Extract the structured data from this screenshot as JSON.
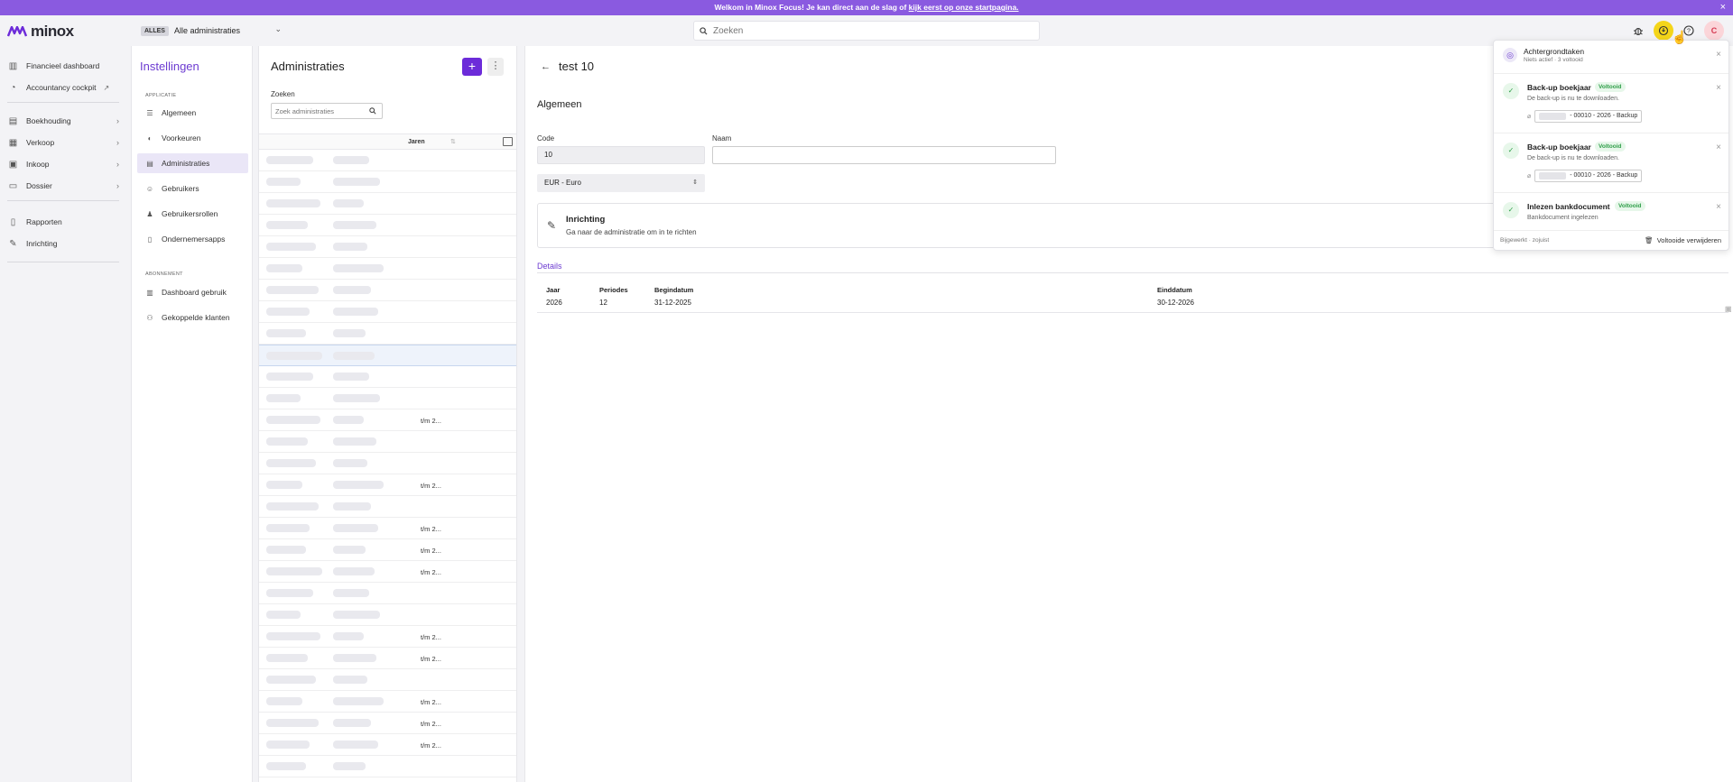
{
  "banner": {
    "text": "Welkom in Minox Focus! Je kan direct aan de slag of ",
    "link": "kijk eerst op onze startpagina.",
    "close": "×"
  },
  "app": {
    "logo_text": "minox"
  },
  "admin_selector": {
    "badge": "ALLES",
    "label": "Alle administraties"
  },
  "search": {
    "placeholder": "Zoeken"
  },
  "user": {
    "initial": "C"
  },
  "nav": [
    {
      "label": "Financieel dashboard",
      "icon": "chart-icon"
    },
    {
      "label": "Accountancy cockpit",
      "icon": "gauge-icon"
    },
    {
      "label": "Boekhouding",
      "icon": "book-icon"
    },
    {
      "label": "Verkoop",
      "icon": "cash-register-icon"
    },
    {
      "label": "Inkoop",
      "icon": "cart-icon"
    },
    {
      "label": "Dossier",
      "icon": "folder-icon"
    },
    {
      "label": "Rapporten",
      "icon": "report-icon"
    },
    {
      "label": "Inrichting",
      "icon": "wrench-icon"
    }
  ],
  "settings": {
    "title": "Instellingen",
    "section_app": "APPLICATIE",
    "section_sub": "ABONNEMENT",
    "items": [
      {
        "label": "Algemeen"
      },
      {
        "label": "Voorkeuren"
      },
      {
        "label": "Administraties"
      },
      {
        "label": "Gebruikers"
      },
      {
        "label": "Gebruikersrollen"
      },
      {
        "label": "Ondernemersapps"
      },
      {
        "label": "Dashboard gebruik"
      },
      {
        "label": "Gekoppelde klanten"
      }
    ]
  },
  "admin_list": {
    "title": "Administraties",
    "search_label": "Zoeken",
    "search_placeholder": "Zoek administraties",
    "column": "Jaren",
    "add": "+",
    "more": "⋮",
    "periods": [
      "",
      "",
      "",
      "",
      "",
      "",
      "",
      "",
      "",
      "",
      "",
      "",
      "t/m 2...",
      "",
      "",
      "t/m 2...",
      "",
      "t/m 2...",
      "t/m 2...",
      "t/m 2...",
      "",
      "",
      "t/m 2...",
      "t/m 2...",
      "",
      "t/m 2...",
      "t/m 2...",
      "t/m 2...",
      "",
      ""
    ]
  },
  "detail": {
    "title": "test 10",
    "section": "Algemeen",
    "code_label": "Code",
    "code_value": "10",
    "name_label": "Naam",
    "currency": "EUR - Euro",
    "inrichting_title": "Inrichting",
    "inrichting_sub": "Ga naar de administratie om in te richten",
    "details_tab": "Details",
    "table": {
      "headers": [
        "Jaar",
        "Periodes",
        "Begindatum",
        "Einddatum"
      ],
      "row": [
        "2026",
        "12",
        "31-12-2025",
        "30-12-2026"
      ]
    }
  },
  "tasks_panel": {
    "title": "Achtergrondtaken",
    "subtitle": "Niets actief · 3 voltooid",
    "tasks": [
      {
        "title": "Back-up boekjaar",
        "status": "Voltooid",
        "subtitle": "De back-up is nu te downloaden.",
        "file": "- 00010 - 2026 - Backup"
      },
      {
        "title": "Back-up boekjaar",
        "status": "Voltooid",
        "subtitle": "De back-up is nu te downloaden.",
        "file": "- 00010 - 2026 - Backup"
      },
      {
        "title": "Inlezen bankdocument",
        "status": "Voltooid",
        "subtitle": "Bankdocument ingelezen"
      }
    ],
    "footer_left": "Bijgewerkt · zojuist",
    "footer_right": "Voltooide verwijderen"
  },
  "colors": {
    "accent": "#6c2bd9",
    "banner": "#8a5ae0",
    "success": "#2e9e48",
    "highlight": "#f4d51a"
  }
}
